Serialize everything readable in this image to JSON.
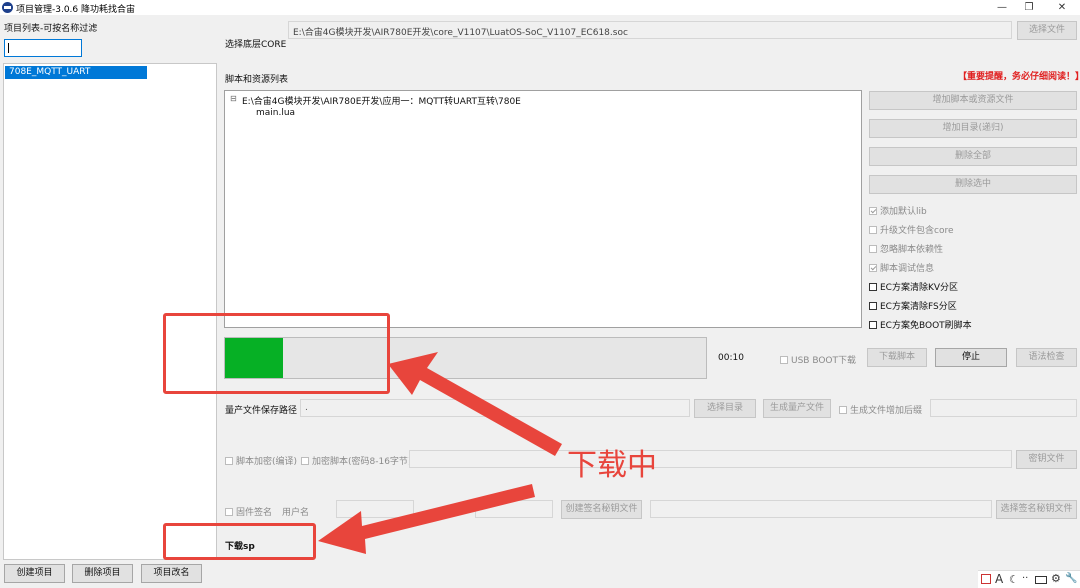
{
  "window": {
    "title": "项目管理-3.0.6 降功耗找合宙",
    "minimize_glyph": "—",
    "restore_glyph": "❐",
    "close_glyph": "✕"
  },
  "left": {
    "filter_label": "项目列表-可按名称过滤",
    "filter_value": "",
    "projects": [
      "708E_MQTT_UART"
    ],
    "buttons": {
      "create": "创建项目",
      "delete": "删除项目",
      "rename": "项目改名"
    }
  },
  "core": {
    "label": "选择底层CORE",
    "path": "E:\\合宙4G模块开发\\AIR780E开发\\core_V1107\\LuatOS-SoC_V1107_EC618.soc",
    "select_button": "选择文件"
  },
  "scripts": {
    "label": "脚本和资源列表",
    "warning": "【重要提醒，务必仔细阅读！】",
    "tree_toggle": "⊟",
    "tree_root": "E:\\合宙4G模块开发\\AIR780E开发\\应用一：MQTT转UART互转\\780E",
    "tree_child": "main.lua"
  },
  "side_buttons": {
    "add_script": "增加脚本或资源文件",
    "add_dir": "增加目录(递归)",
    "delete_all": "删除全部",
    "delete_selected": "删除选中"
  },
  "options": {
    "add_default_lib": "添加默认lib",
    "upgrade_core": "升级文件包含core",
    "ignore_deps": "忽略脚本依赖性",
    "debug_info": "脚本调试信息",
    "ec_kv": "EC方案清除KV分区",
    "ec_fs": "EC方案清除FS分区",
    "ec_boot": "EC方案免BOOT刷脚本"
  },
  "download": {
    "progress_percent": 12,
    "elapsed": "00:10",
    "usb_boot": "USB BOOT下载",
    "download_script": "下载脚本",
    "stop": "停止",
    "syntax_check": "语法检查"
  },
  "mass_production": {
    "label": "量产文件保存路径",
    "path": ".",
    "select_dir": "选择目录",
    "generate": "生成量产文件",
    "append_suffix": "生成文件增加后缀",
    "suffix_value": ""
  },
  "encryption": {
    "encrypt_compile": "脚本加密(编译)",
    "encrypt_password": "加密脚本(密码8-16字节)",
    "password_value": "",
    "key_file": "密钥文件"
  },
  "signature": {
    "firmware_sign": "固件签名",
    "username_label": "用户名",
    "username_value": "",
    "password_value": "",
    "create_key": "创建签名秘钥文件",
    "key_path": "",
    "select_key": "选择签名秘钥文件"
  },
  "status": {
    "text": "下载sp"
  },
  "annotation": {
    "text": "下载中",
    "color": "#e8453c"
  },
  "tray": {
    "icons": [
      "tray-app-icon",
      "font-icon",
      "moon-icon",
      "dots-icon",
      "keyboard-icon",
      "gear-icon",
      "wrench-icon"
    ]
  }
}
